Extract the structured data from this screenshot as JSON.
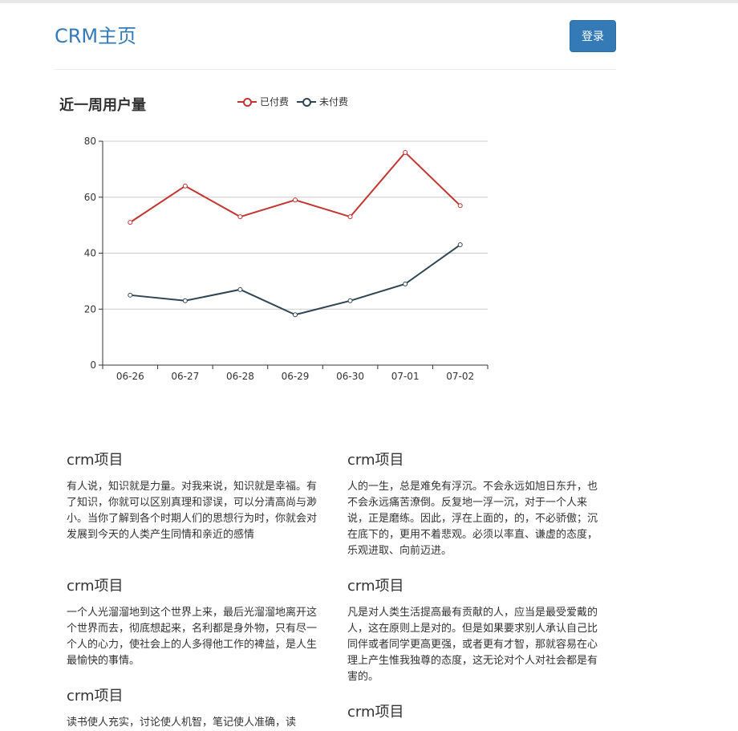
{
  "header": {
    "brand": "CRM主页",
    "login_label": "登录"
  },
  "chart": {
    "title": "近一周用户量",
    "legend": [
      {
        "name": "已付费",
        "color": "#c23531"
      },
      {
        "name": "未付费",
        "color": "#2f4554"
      }
    ]
  },
  "chart_data": {
    "type": "line",
    "title": "近一周用户量",
    "categories": [
      "06-26",
      "06-27",
      "06-28",
      "06-29",
      "06-30",
      "07-01",
      "07-02"
    ],
    "series": [
      {
        "name": "已付费",
        "color": "#c23531",
        "values": [
          51,
          64,
          53,
          59,
          53,
          76,
          57
        ]
      },
      {
        "name": "未付费",
        "color": "#2f4554",
        "values": [
          25,
          23,
          27,
          18,
          23,
          29,
          43
        ]
      }
    ],
    "ylim": [
      0,
      80
    ],
    "yticks": [
      0,
      20,
      40,
      60,
      80
    ],
    "grid": true,
    "legend_position": "top"
  },
  "articles": [
    {
      "title": "crm项目",
      "body": "有人说，知识就是力量。对我来说，知识就是幸福。有了知识，你就可以区别真理和谬误，可以分清高尚与渺小。当你了解到各个时期人们的思想行为时，你就会对发展到今天的人类产生同情和亲近的感情"
    },
    {
      "title": "crm项目",
      "body": "人的一生，总是难免有浮沉。不会永远如旭日东升，也不会永远痛苦潦倒。反复地一浮一沉，对于一个人来说，正是磨练。因此，浮在上面的，的，不必骄傲；沉在底下的，更用不着悲观。必须以率直、谦虚的态度，乐观进取、向前迈进。"
    },
    {
      "title": "crm项目",
      "body": "一个人光溜溜地到这个世界上来，最后光溜溜地离开这个世界而去，彻底想起来，名利都是身外物，只有尽一个人的心力，使社会上的人多得他工作的裨益，是人生最愉快的事情。"
    },
    {
      "title": "crm项目",
      "body": "凡是对人类生活提高最有贡献的人，应当是最受爱戴的人，这在原则上是对的。但是如果要求别人承认自己比同伴或者同学更高更强，或者更有才智，那就容易在心理上产生惟我独尊的态度，这无论对个人对社会都是有害的。"
    },
    {
      "title": "crm项目",
      "body": "读书使人充实，讨论使人机智，笔记使人准确，读"
    },
    {
      "title": "crm项目",
      "body": ""
    }
  ]
}
